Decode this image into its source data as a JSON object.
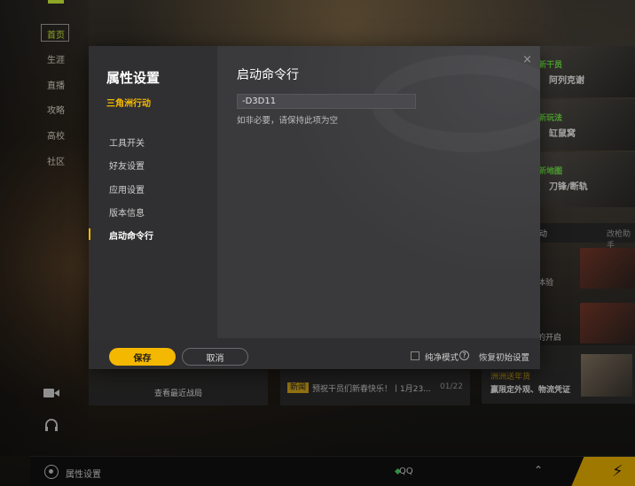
{
  "launcher": {
    "nav": [
      {
        "label": "首页",
        "active": true
      },
      {
        "label": "生涯"
      },
      {
        "label": "直播"
      },
      {
        "label": "攻略"
      },
      {
        "label": "高校"
      },
      {
        "label": "社区"
      }
    ],
    "cards": [
      {
        "tag": "新干员",
        "title": "阿列克谢"
      },
      {
        "tag": "新玩法",
        "title": "缸鼠窝"
      },
      {
        "tag": "新地图",
        "title": "刀锋/断轨"
      }
    ],
    "tabs": [
      "动",
      "改枪助手"
    ],
    "promo_rows": [
      "体验",
      "的开启"
    ],
    "recent_battles": "查看最近战局",
    "news": {
      "tag": "新闻",
      "text": "预祝干员们新春快乐！丨1月23...",
      "date": "01/22"
    },
    "promo": {
      "title": "洲洲送年货",
      "subtitle": "赢限定外观、物流凭证"
    }
  },
  "bottom_bar": {
    "settings_label": "属性设置",
    "qq_label": "QQ",
    "launch_icon": "lightning-icon"
  },
  "dialog": {
    "title": "属性设置",
    "game_name": "三角洲行动",
    "side_items": [
      {
        "label": "工具开关"
      },
      {
        "label": "好友设置"
      },
      {
        "label": "应用设置"
      },
      {
        "label": "版本信息"
      },
      {
        "label": "启动命令行",
        "active": true
      }
    ],
    "section_title": "启动命令行",
    "command_value": "-D3D11",
    "hint": "如非必要，请保持此项为空",
    "save_label": "保存",
    "cancel_label": "取消",
    "clean_mode_label": "纯净模式",
    "restore_label": "恢复初始设置",
    "close_glyph": "×"
  },
  "colors": {
    "accent": "#f5b800",
    "nav_active": "#d9ff3a",
    "tag_green": "#7dff4c"
  }
}
